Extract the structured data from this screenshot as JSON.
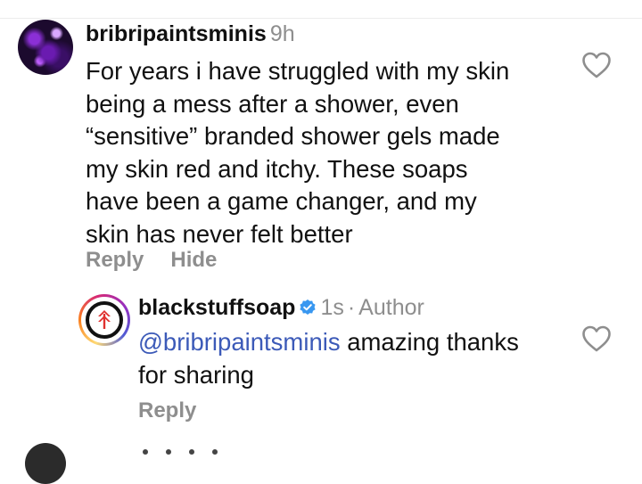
{
  "comment": {
    "username": "bribripaintsminis",
    "time": "9h",
    "text_lines": [
      "For years i have struggled with my skin",
      "being a mess after a shower, even",
      "“sensitive” branded shower gels made",
      "my skin red and itchy. These soaps",
      "have been a game changer, and my",
      "skin has never felt better"
    ],
    "reply_label": "Reply",
    "hide_label": "Hide"
  },
  "reply": {
    "username": "blackstuffsoap",
    "time": "1s",
    "separator": "·",
    "role": "Author",
    "mention": "@bribripaintsminis",
    "text_line1_rest": " amazing thanks",
    "text_line2": "for sharing",
    "reply_label": "Reply"
  },
  "colors": {
    "mention": "#3c5ab8",
    "muted": "#8e8e8e",
    "verified": "#3897f0",
    "logo_red": "#e0312f"
  },
  "icons": {
    "like": "heart-outline-icon",
    "verified": "verified-badge-icon"
  }
}
